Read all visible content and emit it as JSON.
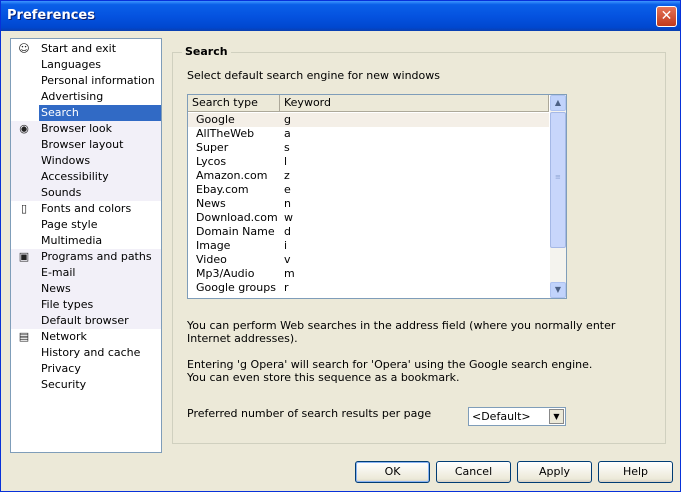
{
  "window": {
    "title": "Preferences",
    "close_glyph": "✕"
  },
  "nav": {
    "items": [
      {
        "label": "Start and exit",
        "icon": "person-icon",
        "glyph": "☺",
        "shade": false
      },
      {
        "label": "Languages",
        "shade": false
      },
      {
        "label": "Personal information",
        "shade": false
      },
      {
        "label": "Advertising",
        "shade": false
      },
      {
        "label": "Search",
        "selected": true,
        "shade": false
      },
      {
        "label": "Browser look",
        "icon": "eye-icon",
        "glyph": "◉",
        "shade": true
      },
      {
        "label": "Browser layout",
        "shade": true
      },
      {
        "label": "Windows",
        "shade": true
      },
      {
        "label": "Accessibility",
        "shade": true
      },
      {
        "label": "Sounds",
        "shade": true
      },
      {
        "label": "Fonts and colors",
        "icon": "page-icon",
        "glyph": "▯",
        "shade": false
      },
      {
        "label": "Page style",
        "shade": false
      },
      {
        "label": "Multimedia",
        "shade": false
      },
      {
        "label": "Programs and paths",
        "icon": "disk-icon",
        "glyph": "▣",
        "shade": true
      },
      {
        "label": "E-mail",
        "shade": true
      },
      {
        "label": "News",
        "shade": true
      },
      {
        "label": "File types",
        "shade": true
      },
      {
        "label": "Default browser",
        "shade": true
      },
      {
        "label": "Network",
        "icon": "lock-icon",
        "glyph": "▤",
        "shade": false
      },
      {
        "label": "History and cache",
        "shade": false
      },
      {
        "label": "Privacy",
        "shade": false
      },
      {
        "label": "Security",
        "shade": false
      }
    ]
  },
  "search": {
    "group_title": "Search",
    "description": "Select default search engine for new windows",
    "columns": [
      "Search type",
      "Keyword"
    ],
    "rows": [
      [
        "Google",
        "g"
      ],
      [
        "AllTheWeb",
        "a"
      ],
      [
        "Super",
        "s"
      ],
      [
        "Lycos",
        "l"
      ],
      [
        "Amazon.com",
        "z"
      ],
      [
        "Ebay.com",
        "e"
      ],
      [
        "News",
        "n"
      ],
      [
        "Download.com",
        "w"
      ],
      [
        "Domain Name",
        "d"
      ],
      [
        "Image",
        "i"
      ],
      [
        "Video",
        "v"
      ],
      [
        "Mp3/Audio",
        "m"
      ],
      [
        "Google groups",
        "r"
      ]
    ],
    "info1_line1": "You can perform Web searches in the address field (where you normally enter",
    "info1_line2": "Internet addresses).",
    "info2_line1": "Entering 'g Opera' will search for 'Opera' using the Google search engine.",
    "info2_line2": "You can even store this sequence as a bookmark.",
    "results_label": "Preferred number of search results per page",
    "results_value": "<Default>"
  },
  "buttons": {
    "ok": "OK",
    "cancel": "Cancel",
    "apply": "Apply",
    "help": "Help"
  }
}
